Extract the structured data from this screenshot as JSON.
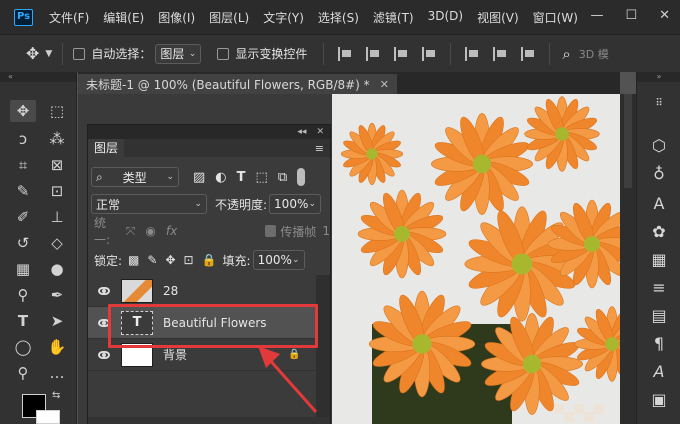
{
  "menubar": {
    "logo": "Ps",
    "items": [
      "文件(F)",
      "编辑(E)",
      "图像(I)",
      "图层(L)",
      "文字(Y)",
      "选择(S)",
      "滤镜(T)",
      "3D(D)",
      "视图(V)",
      "窗口(W)"
    ],
    "minimize": "—",
    "maximize": "☐",
    "close": "✕"
  },
  "options": {
    "auto_select_label": "自动选择：",
    "auto_select_value": "图层",
    "show_transform_label": "显示变换控件",
    "mode_3d_label": "3D 模"
  },
  "document": {
    "tab_title": "未标题-1 @ 100% (Beautiful  Flowers, RGB/8#) *",
    "close": "✕"
  },
  "layers_panel": {
    "title": "图层",
    "filter_label": "类型",
    "blend_mode": "正常",
    "opacity_label": "不透明度:",
    "opacity_value": "100%",
    "unify_label": "统一:",
    "propagate_label": "传播帧",
    "propagate_number": "1",
    "lock_label": "锁定:",
    "fill_label": "填充:",
    "fill_value": "100%",
    "layers": [
      {
        "name": "28",
        "type": "image"
      },
      {
        "name": "Beautiful  Flowers",
        "type": "text",
        "thumb_glyph": "T"
      },
      {
        "name": "背景",
        "type": "background"
      }
    ]
  },
  "colors": {
    "highlight_box": "#e23a3a",
    "arrow": "#e23a3a",
    "accent": "#31a8ff",
    "flower_orange": "#f0862c",
    "flower_center": "#a8b82e"
  }
}
